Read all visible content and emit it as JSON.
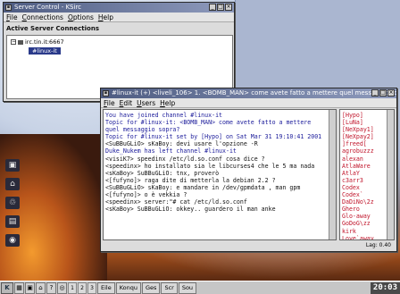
{
  "server_window": {
    "title": "Server Control - KSirc",
    "menu": [
      "File",
      "Connections",
      "Options",
      "Help"
    ],
    "section_title": "Active Server Connections",
    "server_node": "irc.tin.it:6667",
    "channel_node": "#linux-it"
  },
  "chat_window": {
    "title": "#linux-it (+) <liveli_106> 1. <BOMB_MAN> come avete fatto a mettere quel messaggio sopra?",
    "menu": [
      "File",
      "Edit",
      "Users",
      "Help"
    ],
    "lines": [
      {
        "text": "You have joined channel #linux-it",
        "sys": true
      },
      {
        "text": "Topic for #linux-it: <BOMB_MAN> come avete fatto a mettere quel messaggio sopra?",
        "sys": true
      },
      {
        "text": "Topic for #linux-it set by [Hypo] on Sat Mar 31 19:10:41 2001",
        "sys": true
      },
      {
        "text": "<SuBBuGLiO> sKaBoy: devi usare l'opzione -R",
        "sys": false
      },
      {
        "text": "Duke_Nukem has left channel #linux-it",
        "sys": true
      },
      {
        "text": "<visiK7> speedinx /etc/ld.so.conf cosa dice ?",
        "sys": false
      },
      {
        "text": "<speedinx> ho installato sia le libcurses4 che le 5 ma nada",
        "sys": false
      },
      {
        "text": "<sKaBoy> SuBBuGLiO: tnx, proverò",
        "sys": false
      },
      {
        "text": "<[fufyno]> raga dite di metterla la debian 2.2 ?",
        "sys": false
      },
      {
        "text": "<SuBBuGLiO> sKaBoy: e mandare in /dev/gpmdata , man gpm",
        "sys": false
      },
      {
        "text": "<[fufyno]> o è vekkia ?",
        "sys": false
      },
      {
        "text": "<speedinx> server:\"# cat /etc/ld.so.conf",
        "sys": false
      },
      {
        "text": "<sKaBoy> SuBBuGLiO: okkey.. guardero il man anke",
        "sys": false
      }
    ],
    "nicks": [
      "[Hypo]",
      "[LuNa]",
      "[NeXpay1]",
      "[NeXpay2]",
      "]freed[",
      "agrobuzzz",
      "alexan",
      "AtlaWare",
      "AtlaY",
      "c3arr3",
      "Codex",
      "Codex`",
      "DaDiNo\\2z",
      "Ghero",
      "Glo-away",
      "GoDoG\\zz",
      "kirk",
      "Love`away",
      "M0rph3u5"
    ],
    "status": "Lag: 0.40"
  },
  "desktop_icons": [
    "terminal-icon",
    "home-icon",
    "trash-icon",
    "disk-icon",
    "cdrom-icon"
  ],
  "taskbar": {
    "start_label": "K",
    "tasks": [
      "Eile",
      "Konqu",
      "Ges",
      "Scr",
      "Sou"
    ],
    "clock": "20:03"
  }
}
